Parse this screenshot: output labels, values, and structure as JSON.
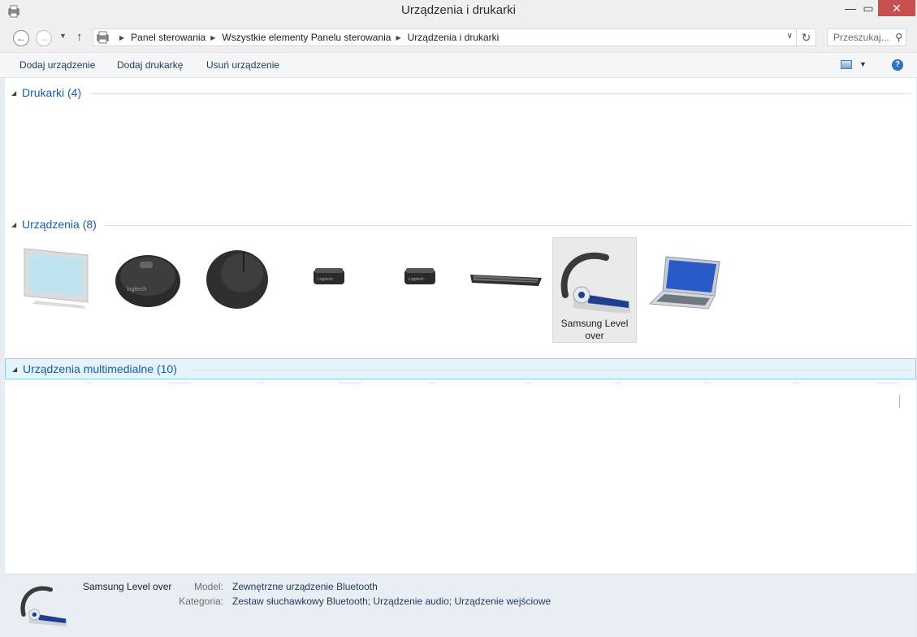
{
  "window": {
    "title": "Urządzenia i drukarki",
    "controls": {
      "minimize": "—",
      "maximize": "▭",
      "close": "✕"
    }
  },
  "address": {
    "crumbs": [
      "Panel sterowania",
      "Wszystkie elementy Panelu sterowania",
      "Urządzenia i drukarki"
    ],
    "search_placeholder": "Przeszukaj...",
    "icons": {
      "back": "back-arrow-icon",
      "forward": "forward-arrow-icon",
      "up": "up-arrow-icon",
      "refresh": "refresh-icon",
      "search": "magnifier-icon"
    }
  },
  "toolbar": {
    "add_device": "Dodaj urządzenie",
    "add_printer": "Dodaj drukarkę",
    "remove_device": "Usuń urządzenie",
    "help": "?"
  },
  "groups": {
    "printers": "Drukarki (4)",
    "devices": "Urządzenia (8)",
    "multimedia": "Urządzenia multimedialne (10)"
  },
  "devices": [
    {
      "icon": "monitor-icon",
      "label": ""
    },
    {
      "icon": "logitech-mouse-icon",
      "label": ""
    },
    {
      "icon": "mouse-icon",
      "label": ""
    },
    {
      "icon": "usb-receiver-icon",
      "label": ""
    },
    {
      "icon": "usb-receiver-icon",
      "label": ""
    },
    {
      "icon": "keyboard-icon",
      "label": ""
    },
    {
      "icon": "bluetooth-headset-icon",
      "label": "Samsung Level over"
    },
    {
      "icon": "laptop-icon",
      "label": ""
    }
  ],
  "details": {
    "name": "Samsung Level over",
    "model_key": "Model:",
    "model_value": "Zewnętrzne urządzenie Bluetooth",
    "category_key": "Kategoria:",
    "category_value": "Zestaw słuchawkowy Bluetooth; Urządzenie audio; Urządzenie wejściowe"
  },
  "colors": {
    "group_title": "#1e5aa0",
    "selected_group_bg": "#e5f3fb",
    "close_button": "#c7504f",
    "details_bg": "#e9eef5"
  }
}
